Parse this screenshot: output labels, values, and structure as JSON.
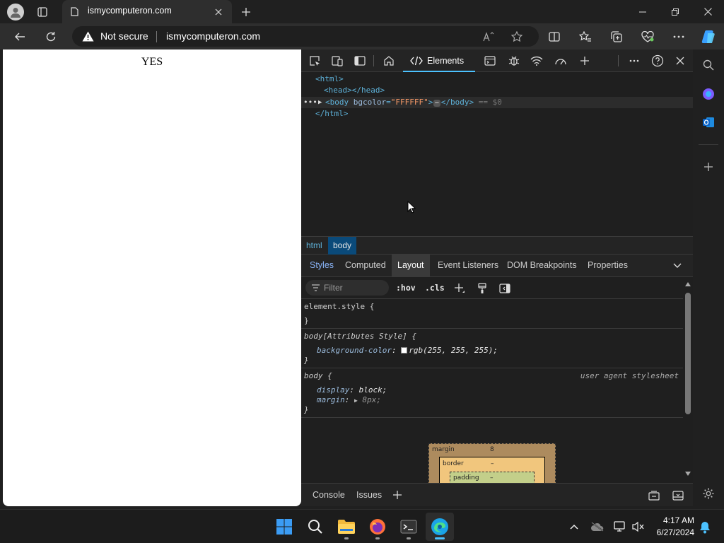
{
  "browser": {
    "tab_title": "ismycomputeron.com",
    "security_label": "Not secure",
    "url": "ismycomputeron.com"
  },
  "page": {
    "text": "YES"
  },
  "devtools": {
    "elements_tab_label": "Elements",
    "dom": {
      "html_open": "<html>",
      "head_open": "<head>",
      "head_close": "</head>",
      "body_open_tag": "<body",
      "body_attr_name": "bgcolor",
      "body_attr_eq": "=",
      "body_attr_value": "\"FFFFFF\"",
      "body_gt": ">",
      "body_close": "</body>",
      "body_console_ref": "== $0",
      "html_close": "</html>"
    },
    "breadcrumbs": [
      "html",
      "body"
    ],
    "subtabs": [
      "Styles",
      "Computed",
      "Layout",
      "Event Listeners",
      "DOM Breakpoints",
      "Properties"
    ],
    "active_subtab": "Layout",
    "filter_placeholder": "Filter",
    "hov_label": ":hov",
    "cls_label": ".cls",
    "styles": {
      "element_style_selector": "element.style {",
      "close_brace": "}",
      "attr_rule_selector": "body[Attributes Style] {",
      "bg_prop": "background-color",
      "bg_value": "rgb(255, 255, 255);",
      "body_rule_selector": "body {",
      "ua_label": "user agent stylesheet",
      "display_prop": "display",
      "display_value": "block;",
      "margin_prop": "margin",
      "margin_value": "8px;"
    },
    "box_model": {
      "margin_label": "margin",
      "margin_value": "8",
      "border_label": "border",
      "border_value": "–",
      "padding_label": "padding",
      "padding_value": "–"
    },
    "drawer_tabs": [
      "Console",
      "Issues"
    ]
  },
  "taskbar": {
    "time": "4:17 AM",
    "date": "6/27/2024"
  },
  "colors": {
    "accent": "#4cc2ff",
    "page_bg": "#FFFFFF",
    "devtools_bg": "#1f1f1f"
  }
}
